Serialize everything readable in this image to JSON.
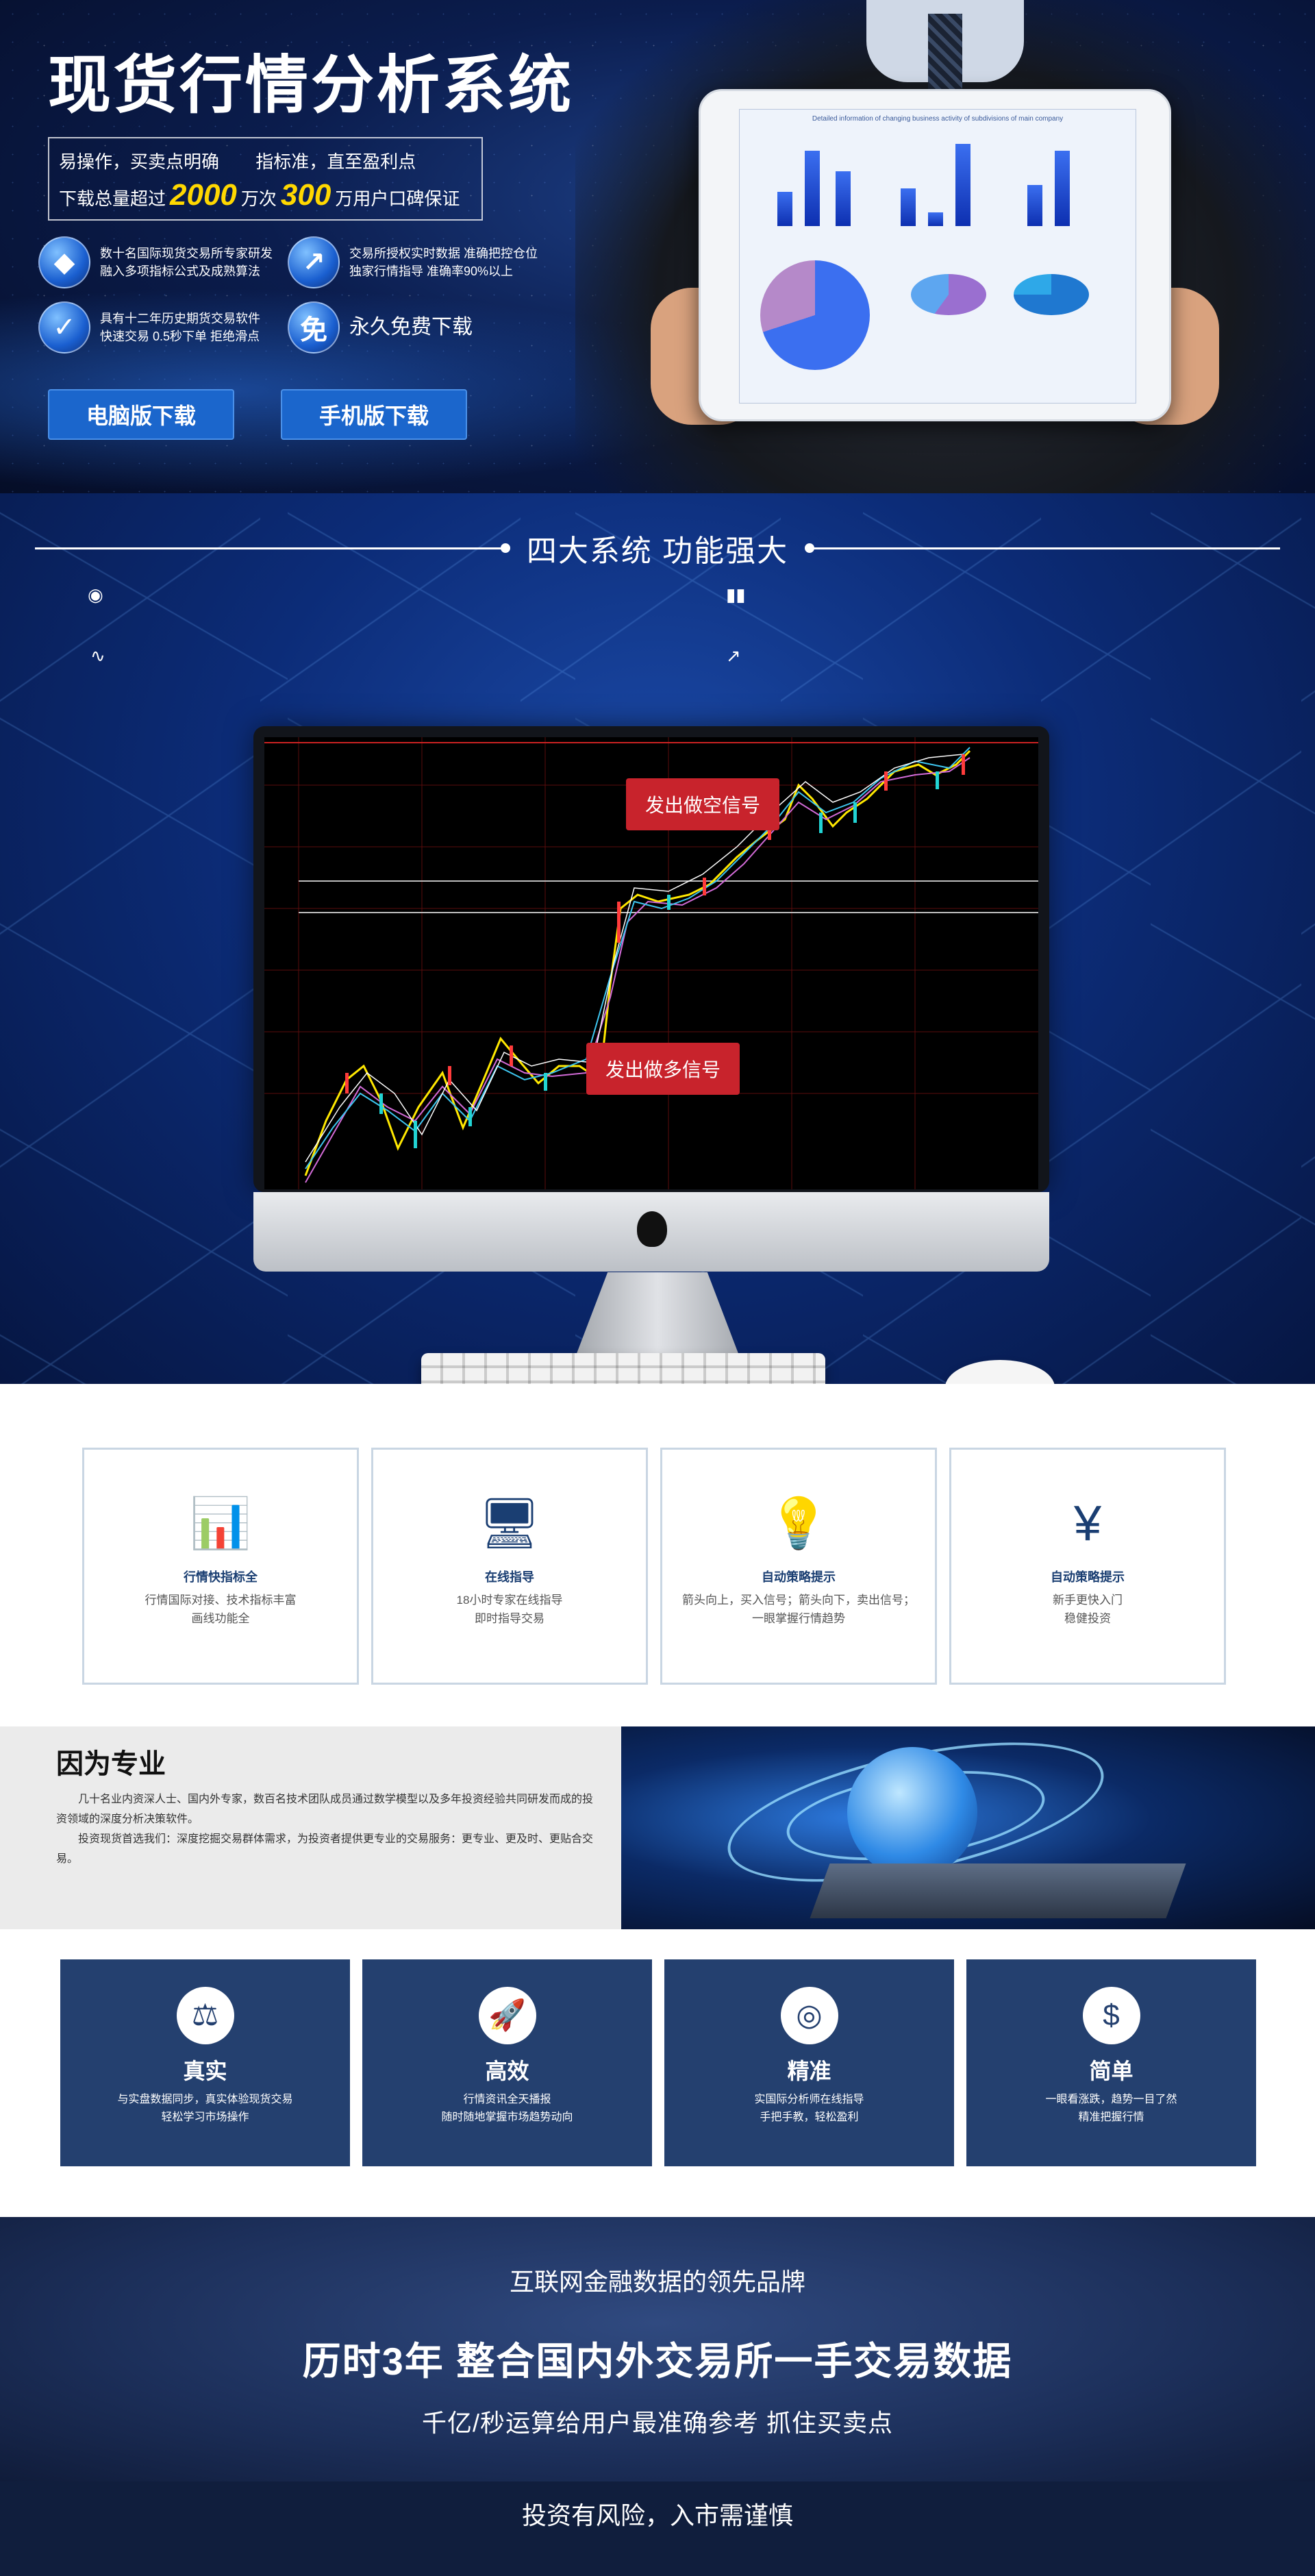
{
  "hero": {
    "title": "现货行情分析系统",
    "tagline_a": "易操作，买卖点明确",
    "tagline_b": "指标准，直至盈利点",
    "download_prefix": "下载总量超过",
    "download_count": "2000",
    "download_mid": "万次",
    "users_count": "300",
    "download_suffix": "万用户口碑保证",
    "features": [
      {
        "icon": "diamond-icon",
        "line1": "数十名国际现货交易所专家研发",
        "line2": "融入多项指标公式及成熟算法"
      },
      {
        "icon": "rising-chart-icon",
        "line1": "交易所授权实时数据 准确把控仓位",
        "line2": "独家行情指导 准确率90%以上"
      },
      {
        "icon": "shield-icon",
        "line1": "具有十二年历史期货交易软件",
        "line2": "快速交易 0.5秒下单 拒绝滑点"
      },
      {
        "icon": "free-badge-icon",
        "glyph": "免",
        "line1": "永久免费下载"
      }
    ],
    "pc_download": "电脑版下载",
    "mobile_download": "手机版下载",
    "tablet_caption": "Detailed information of changing business activity of subdivisions of main company"
  },
  "systems": {
    "heading": "四大系统  功能强大",
    "signal_short": "发出做空信号",
    "signal_long": "发出做多信号"
  },
  "cards": [
    {
      "icon": "bar-chart-icon",
      "title": "行情快指标全",
      "line1": "行情国际对接、技术指标丰富",
      "line2": "画线功能全"
    },
    {
      "icon": "monitor-check-icon",
      "title": "在线指导",
      "line1": "18小时专家在线指导",
      "line2": "即时指导交易"
    },
    {
      "icon": "lightbulb-icon",
      "title": "自动策略提示",
      "line1": "箭头向上，买入信号；箭头向下，卖出信号；",
      "line2": "一眼掌握行情趋势"
    },
    {
      "icon": "yen-cycle-icon",
      "title": "自动策略提示",
      "line1": "新手更快入门",
      "line2": "稳健投资"
    }
  ],
  "pro": {
    "title": "因为专业",
    "para1": "几十名业内资深人士、国内外专家，数百名技术团队成员通过数学模型以及多年投资经验共同研发而成的投资领域的深度分析决策软件。",
    "para2": "投资现货首选我们：深度挖掘交易群体需求，为投资者提供更专业的交易服务：更专业、更及时、更贴合交易。"
  },
  "quad": [
    {
      "icon": "scale-icon",
      "glyph": "⚖",
      "title": "真实",
      "line1": "与实盘数据同步，真实体验现货交易",
      "line2": "轻松学习市场操作"
    },
    {
      "icon": "rocket-icon",
      "glyph": "🚀",
      "title": "高效",
      "line1": "行情资讯全天播报",
      "line2": "随时随地掌握市场趋势动向"
    },
    {
      "icon": "target-icon",
      "glyph": "◎",
      "title": "精准",
      "line1": "实国际分析师在线指导",
      "line2": "手把手教，轻松盈利"
    },
    {
      "icon": "money-icon",
      "glyph": "$",
      "title": "简单",
      "line1": "一眼看涨跌，趋势一目了然",
      "line2": "精准把握行情"
    }
  ],
  "brand": {
    "line1": "互联网金融数据的领先品牌",
    "line2": "历时3年 整合国内外交易所一手交易数据",
    "line3": "千亿/秒运算给用户最准确参考 抓住买卖点"
  },
  "risk": "投资有风险，入市需谨慎",
  "colors": {
    "hero_bg": "#0b1d4e",
    "button_blue": "#1b66cc",
    "highlight_yellow": "#ffd800",
    "signal_red": "#c8232c",
    "card_navy": "#24406f"
  }
}
